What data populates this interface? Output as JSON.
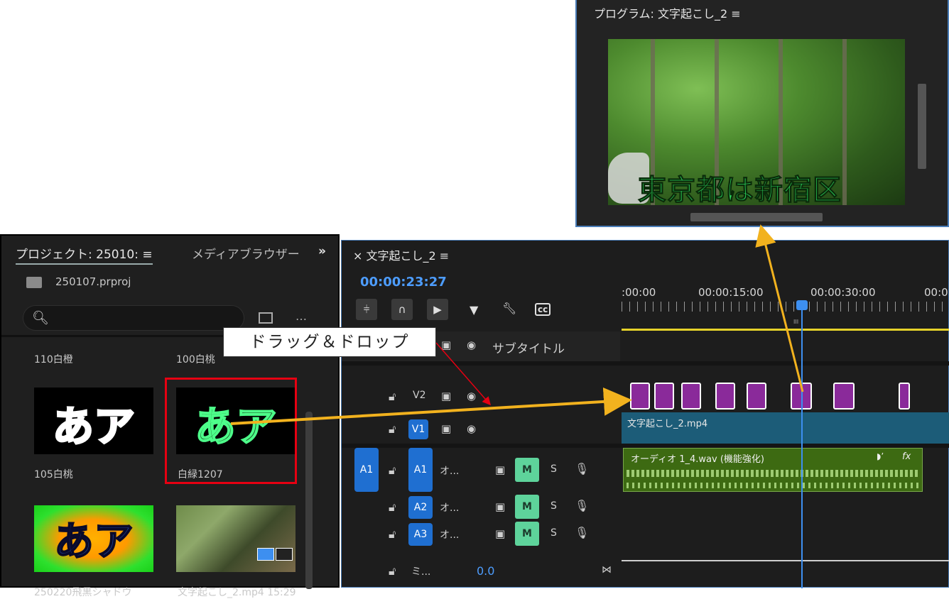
{
  "program_monitor": {
    "title": "プログラム: 文字起こし_2 ≡",
    "caption_text": "東京都は新宿区"
  },
  "project_panel": {
    "tab_project": "プロジェクト: 25010: ≡",
    "tab_media_browser": "メディアブラウザー",
    "more_tabs_icon": "»",
    "project_file": "250107.prproj",
    "search_placeholder": "",
    "menu_icon": "…",
    "items": [
      {
        "label": "110白橙",
        "thumb_text": ""
      },
      {
        "label": "100白桃",
        "thumb_text": ""
      },
      {
        "label": "105白桃",
        "thumb_text": "あア"
      },
      {
        "label": "白緑1207",
        "thumb_text": "あア"
      },
      {
        "label": "250220飛黒シャドウ",
        "thumb_text": "あア"
      },
      {
        "label": "文字起こし_2.mp4 15:29",
        "thumb_text": ""
      }
    ]
  },
  "timeline": {
    "sequence_tab": "× 文字起こし_2 ≡",
    "timecode": "00:00:23:27",
    "ruler_labels": [
      ":00:00",
      "00:00:15:00",
      "00:00:30:00",
      "00:0"
    ],
    "subtitle_track": "サブタイトル",
    "tracks": {
      "v2": "V2",
      "v1": "V1",
      "a1_source": "A1",
      "a1": "A1",
      "a2": "A2",
      "a3": "A3",
      "a_name": "オ...",
      "mix_name": "ミ...",
      "mix_value": "0.0",
      "m_label": "M",
      "s_label": "S"
    },
    "v1_clip_label": "文字起こし_2.mp4",
    "a1_clip_label": "オーディオ 1_4.wav (機能強化)",
    "a1_fx": "fx",
    "ruler_marker": "III"
  },
  "annotation": {
    "drag_label": "ドラッグ＆ドロップ"
  },
  "colors": {
    "accent_blue": "#4d9dff",
    "annotation_red": "#e60012",
    "arrow_orange": "#f2b21e",
    "clip_purple": "#8a2a9a"
  }
}
